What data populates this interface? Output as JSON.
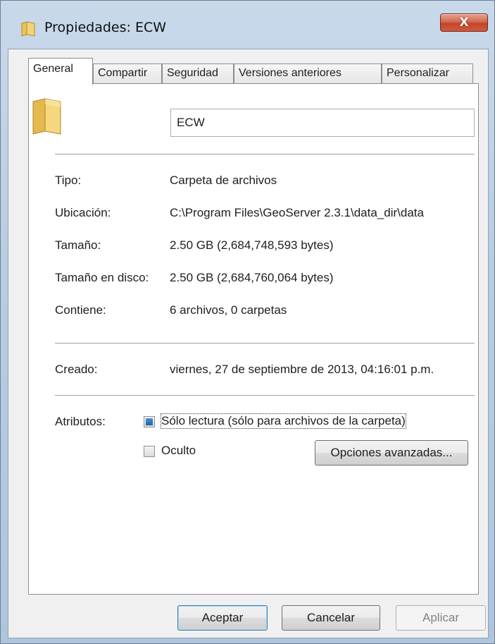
{
  "window": {
    "title": "Propiedades: ECW",
    "close_symbol": "X"
  },
  "tabs": [
    {
      "label": "General",
      "active": true
    },
    {
      "label": "Compartir",
      "active": false
    },
    {
      "label": "Seguridad",
      "active": false
    },
    {
      "label": "Versiones anteriores",
      "active": false
    },
    {
      "label": "Personalizar",
      "active": false
    }
  ],
  "general": {
    "folder_icon": "folder-icon",
    "name_value": "ECW",
    "properties": [
      {
        "label": "Tipo:",
        "value": "Carpeta de archivos"
      },
      {
        "label": "Ubicación:",
        "value": "C:\\Program Files\\GeoServer 2.3.1\\data_dir\\data"
      },
      {
        "label": "Tamaño:",
        "value": "2.50 GB (2,684,748,593 bytes)"
      },
      {
        "label": "Tamaño en disco:",
        "value": "2.50 GB (2,684,760,064 bytes)"
      },
      {
        "label": "Contiene:",
        "value": "6 archivos, 0 carpetas"
      }
    ],
    "created": {
      "label": "Creado:",
      "value": "viernes, 27 de septiembre de 2013, 04:16:01 p.m."
    },
    "attributes": {
      "label": "Atributos:",
      "readonly_label": "Sólo lectura (sólo para archivos de la carpeta)",
      "readonly_state": "indeterminate",
      "hidden_label": "Oculto",
      "hidden_checked": false,
      "advanced_button": "Opciones avanzadas..."
    }
  },
  "footer": {
    "ok": "Aceptar",
    "cancel": "Cancelar",
    "apply": "Aplicar"
  },
  "colors": {
    "checkbox_indeterminate": "#1f5fa8",
    "close_button": "#c2452b"
  }
}
